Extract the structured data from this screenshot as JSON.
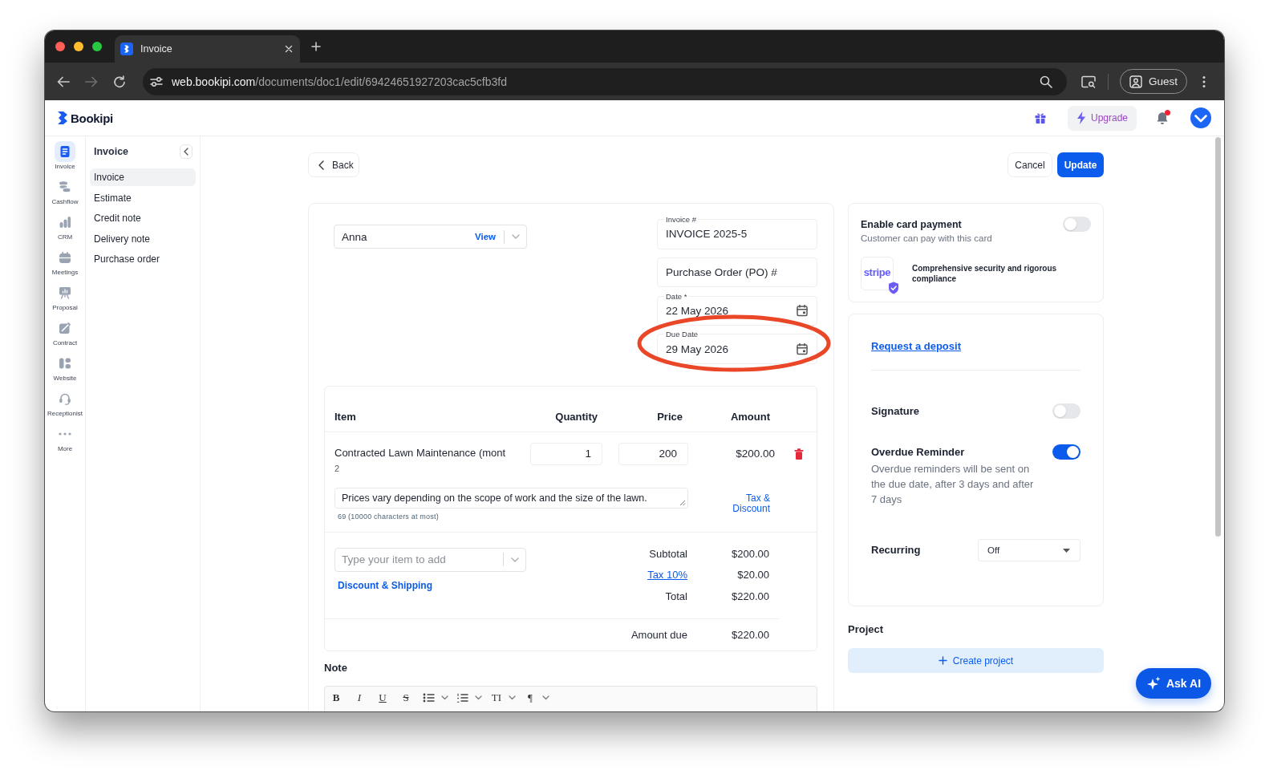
{
  "browser": {
    "tabs": [
      {
        "title": "Invoice",
        "selected": true
      }
    ],
    "nav_buttons": [
      {
        "kind": "back",
        "disabled": false
      },
      {
        "kind": "forward",
        "disabled": true
      },
      {
        "kind": "reload",
        "disabled": false
      }
    ],
    "url": {
      "host": "web.bookipi.com",
      "path": "/documents/doc1/edit/69424651927203cac5cfb3fd"
    },
    "profile": "Guest"
  },
  "app_header": {
    "logo": "Bookipi",
    "upgrade": "Upgrade",
    "notifications_unread": true
  },
  "icon_rail": [
    {
      "kind": "invoice",
      "label": "Invoice",
      "selected": true
    },
    {
      "kind": "cashflow",
      "label": "Cashflow",
      "selected": false
    },
    {
      "kind": "crm",
      "label": "CRM",
      "selected": false
    },
    {
      "kind": "meetings",
      "label": "Meetings",
      "selected": false
    },
    {
      "kind": "proposal",
      "label": "Proposal",
      "selected": false
    },
    {
      "kind": "contract",
      "label": "Contract",
      "selected": false
    },
    {
      "kind": "website",
      "label": "Website",
      "selected": false
    },
    {
      "kind": "receptionist",
      "label": "Receptionist",
      "selected": false
    },
    {
      "kind": "more",
      "label": "More",
      "selected": false
    }
  ],
  "nav_panel": {
    "title": "Invoice",
    "items": [
      {
        "label": "Invoice",
        "selected": true
      },
      {
        "label": "Estimate",
        "selected": false
      },
      {
        "label": "Credit note",
        "selected": false
      },
      {
        "label": "Delivery note",
        "selected": false
      },
      {
        "label": "Purchase order",
        "selected": false
      }
    ]
  },
  "actions": {
    "back": "Back",
    "cancel": "Cancel",
    "update": "Update"
  },
  "client": {
    "name": "Anna",
    "link": "View"
  },
  "fields": [
    {
      "kind": "text",
      "label": "Invoice #",
      "value": "INVOICE 2025-5",
      "circled": false
    },
    {
      "kind": "text",
      "placeholder": "Purchase Order (PO) #",
      "circled": false
    },
    {
      "kind": "date",
      "label": "Date *",
      "value": "22 May 2026",
      "circled": false
    },
    {
      "kind": "date",
      "label": "Due Date",
      "value": "29 May 2026",
      "circled": true
    }
  ],
  "line_items": {
    "columns": [
      "Item",
      "Quantity",
      "Price",
      "Amount"
    ],
    "rows": [
      {
        "item": "Contracted Lawn Maintenance (mont",
        "item_line_2": "2",
        "quantity": "1",
        "price": "200",
        "amount": "$200.00",
        "description": "Prices vary depending on the scope of work and the size of the lawn.",
        "char_count": "69 (10000 characters at most)",
        "tax_link": "Tax & Discount"
      }
    ],
    "add_item": {
      "placeholder": "Type your item to add"
    },
    "discount_link": "Discount & Shipping",
    "totals": [
      {
        "kind": "plain",
        "label": "Subtotal",
        "value": "$200.00"
      },
      {
        "kind": "link",
        "label": "Tax 10%",
        "value": "$20.00"
      },
      {
        "kind": "plain",
        "label": "Total",
        "value": "$220.00"
      }
    ],
    "amount_due": {
      "label": "Amount due",
      "value": "$220.00"
    }
  },
  "note": {
    "title": "Note",
    "tools": [
      {
        "kind": "bold",
        "glyph": "B",
        "dropdown": false
      },
      {
        "kind": "italic",
        "glyph": "I",
        "dropdown": false
      },
      {
        "kind": "underline",
        "glyph": "U",
        "dropdown": false
      },
      {
        "kind": "strike",
        "glyph": "S",
        "dropdown": false
      },
      {
        "kind": "bullets",
        "dropdown": true
      },
      {
        "kind": "numbered",
        "dropdown": true
      },
      {
        "kind": "font_size",
        "glyph": "TI",
        "dropdown": true
      },
      {
        "kind": "paragraph",
        "glyph": "¶",
        "dropdown": true
      }
    ]
  },
  "card_payment": {
    "title": "Enable card payment",
    "subtitle": "Customer can pay with this card",
    "on": false,
    "logo_text": "stripe",
    "security_text": "Comprehensive security and rigorous compliance"
  },
  "settings": {
    "deposit_link": "Request a deposit",
    "rows": [
      {
        "kind": "toggle",
        "label": "Signature",
        "on": false
      },
      {
        "kind": "toggle",
        "label": "Overdue Reminder",
        "on": true,
        "description": "Overdue reminders will be sent on the due date, after 3 days and after 7 days"
      },
      {
        "kind": "select",
        "label": "Recurring",
        "value": "Off"
      }
    ]
  },
  "project": {
    "title": "Project",
    "button": "Create project"
  },
  "ask_ai": "Ask AI"
}
